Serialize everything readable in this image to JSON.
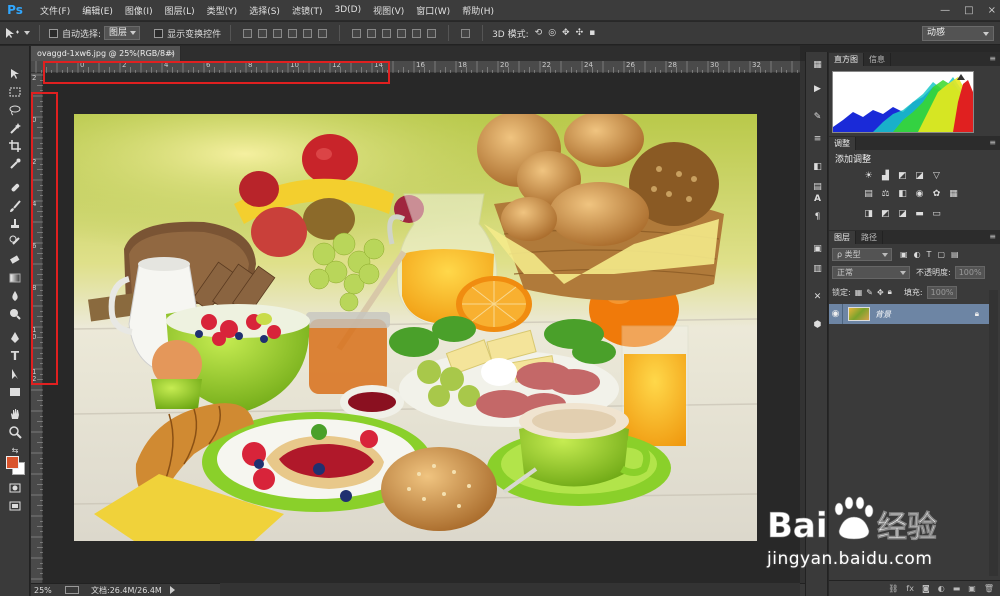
{
  "app": {
    "logo": "Ps"
  },
  "menu": {
    "items": [
      "文件(F)",
      "编辑(E)",
      "图像(I)",
      "图层(L)",
      "类型(Y)",
      "选择(S)",
      "滤镜(T)",
      "3D(D)",
      "视图(V)",
      "窗口(W)",
      "帮助(H)"
    ]
  },
  "window_controls": {
    "minimize": "—",
    "restore": "□",
    "close": "×"
  },
  "options": {
    "auto_select_label": "自动选择:",
    "auto_select_value": "图层",
    "show_transform_label": "显示变换控件",
    "mode_3d_label": "3D 模式:",
    "workspace": "动感"
  },
  "document": {
    "tab_title": "ovaggd-1xw6.jpg @ 25%(RGB/8#)",
    "tab_close": "×"
  },
  "rulers": {
    "h_labels": [
      "0",
      "2",
      "4",
      "6",
      "8",
      "10",
      "12",
      "14",
      "16",
      "18",
      "20",
      "22",
      "24",
      "26",
      "28",
      "30",
      "32"
    ],
    "v_labels": [
      "2",
      "0",
      "2",
      "4",
      "6",
      "8",
      "1\n0",
      "1\n2"
    ]
  },
  "status": {
    "zoom": "25%",
    "doc_size": "文档:26.4M/26.4M"
  },
  "panels": {
    "histogram_tabs": [
      "直方图",
      "信息"
    ],
    "adjustments_tab": "调整",
    "adjustments_title": "添加调整",
    "layers_tabs": [
      "图层",
      "路径"
    ],
    "kind_filter": "ρ 类型",
    "blend_mode": "正常",
    "opacity_label": "不透明度:",
    "opacity_value": "100%",
    "lock_label": "锁定:",
    "fill_label": "填充:",
    "fill_value": "100%",
    "layer_name": "背景"
  },
  "watermark": {
    "brand": "Baidu经验",
    "url": "jingyan.baidu.com"
  },
  "colors": {
    "highlight": "#e02020",
    "layer_selected": "#6d85a4",
    "ps_blue": "#31a8ff"
  }
}
